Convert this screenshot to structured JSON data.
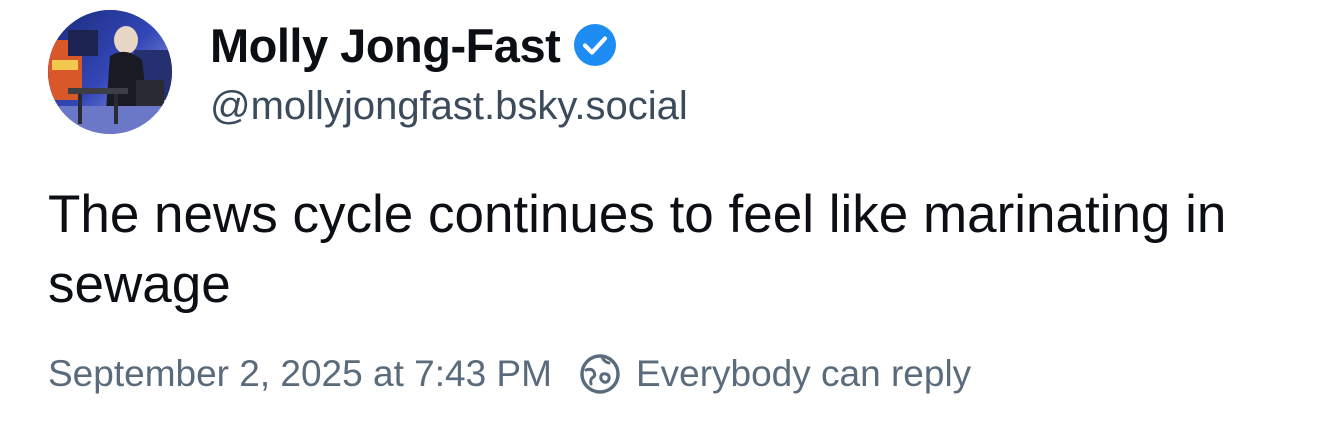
{
  "author": {
    "display_name": "Molly Jong-Fast",
    "handle": "@mollyjongfast.bsky.social",
    "avatar_icon": "profile-photo",
    "verified_icon": "verified-check-icon",
    "verified_color": "#1d8cf3"
  },
  "post": {
    "text": "The news cycle continues to feel like marinating in sewage"
  },
  "meta": {
    "timestamp": "September 2, 2025 at 7:43 PM",
    "reply_setting": "Everybody can reply",
    "reply_icon": "globe-reply-icon"
  },
  "colors": {
    "name": "#0b0f14",
    "handle": "#3c4b5c",
    "meta": "#5a6b7c"
  }
}
